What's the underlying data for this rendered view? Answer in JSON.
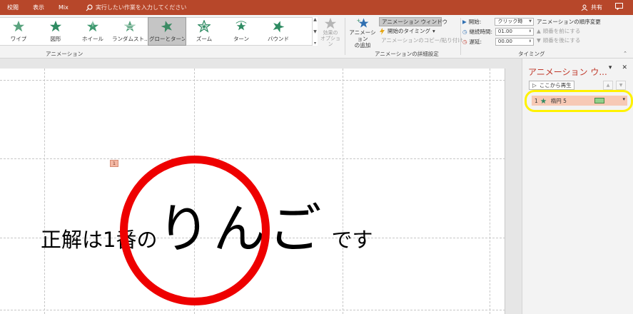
{
  "titlebar": {
    "tabs": [
      "校閲",
      "表示",
      "Mix"
    ],
    "tell_me": "実行したい作業を入力してください",
    "share_label": "共有"
  },
  "ribbon": {
    "animations": [
      {
        "label": "ワイプ",
        "icon": "wipe-star-icon",
        "selected": false
      },
      {
        "label": "図形",
        "icon": "shape-star-icon",
        "selected": false
      },
      {
        "label": "ホイール",
        "icon": "wheel-star-icon",
        "selected": false
      },
      {
        "label": "ランダムスト...",
        "icon": "random-bars-star-icon",
        "selected": false
      },
      {
        "label": "グローとターン",
        "icon": "grow-turn-star-icon",
        "selected": true
      },
      {
        "label": "ズーム",
        "icon": "zoom-star-icon",
        "selected": false
      },
      {
        "label": "ターン",
        "icon": "swivel-star-icon",
        "selected": false
      },
      {
        "label": "バウンド",
        "icon": "bounce-star-icon",
        "selected": false
      }
    ],
    "effect_options_label": "効果の\nオプション",
    "group_animation_label": "アニメーション",
    "add_animation_label": "アニメーション\nの追加",
    "advanced": {
      "pane_label": "アニメーション ウィンドウ",
      "trigger_label": "開始のタイミング",
      "painter_label": "アニメーションのコピー/貼り付け"
    },
    "group_advanced_label": "アニメーションの詳細設定",
    "timing": {
      "start_label": "開始:",
      "start_value": "クリック時",
      "duration_label": "継続時間:",
      "duration_value": "01.00",
      "delay_label": "遅延:",
      "delay_value": "00.00"
    },
    "group_timing_label": "タイミング",
    "reorder": {
      "title": "アニメーションの順序変更",
      "earlier": "順番を前にする",
      "later": "順番を後にする"
    }
  },
  "slide": {
    "marker": "1",
    "text_before": "正解は1番の",
    "text_big": "りんご",
    "text_after": "です",
    "circle_color": "#ee0000"
  },
  "pane": {
    "title": "アニメーション ウ...",
    "play_from": "ここから再生",
    "items": [
      {
        "number": "1",
        "name": "楕円 5"
      }
    ]
  },
  "colors": {
    "accent": "#b7472a",
    "selection_highlight": "#fff200",
    "item_bg": "#f7c9b5",
    "timeline_bar": "#92d18b"
  }
}
